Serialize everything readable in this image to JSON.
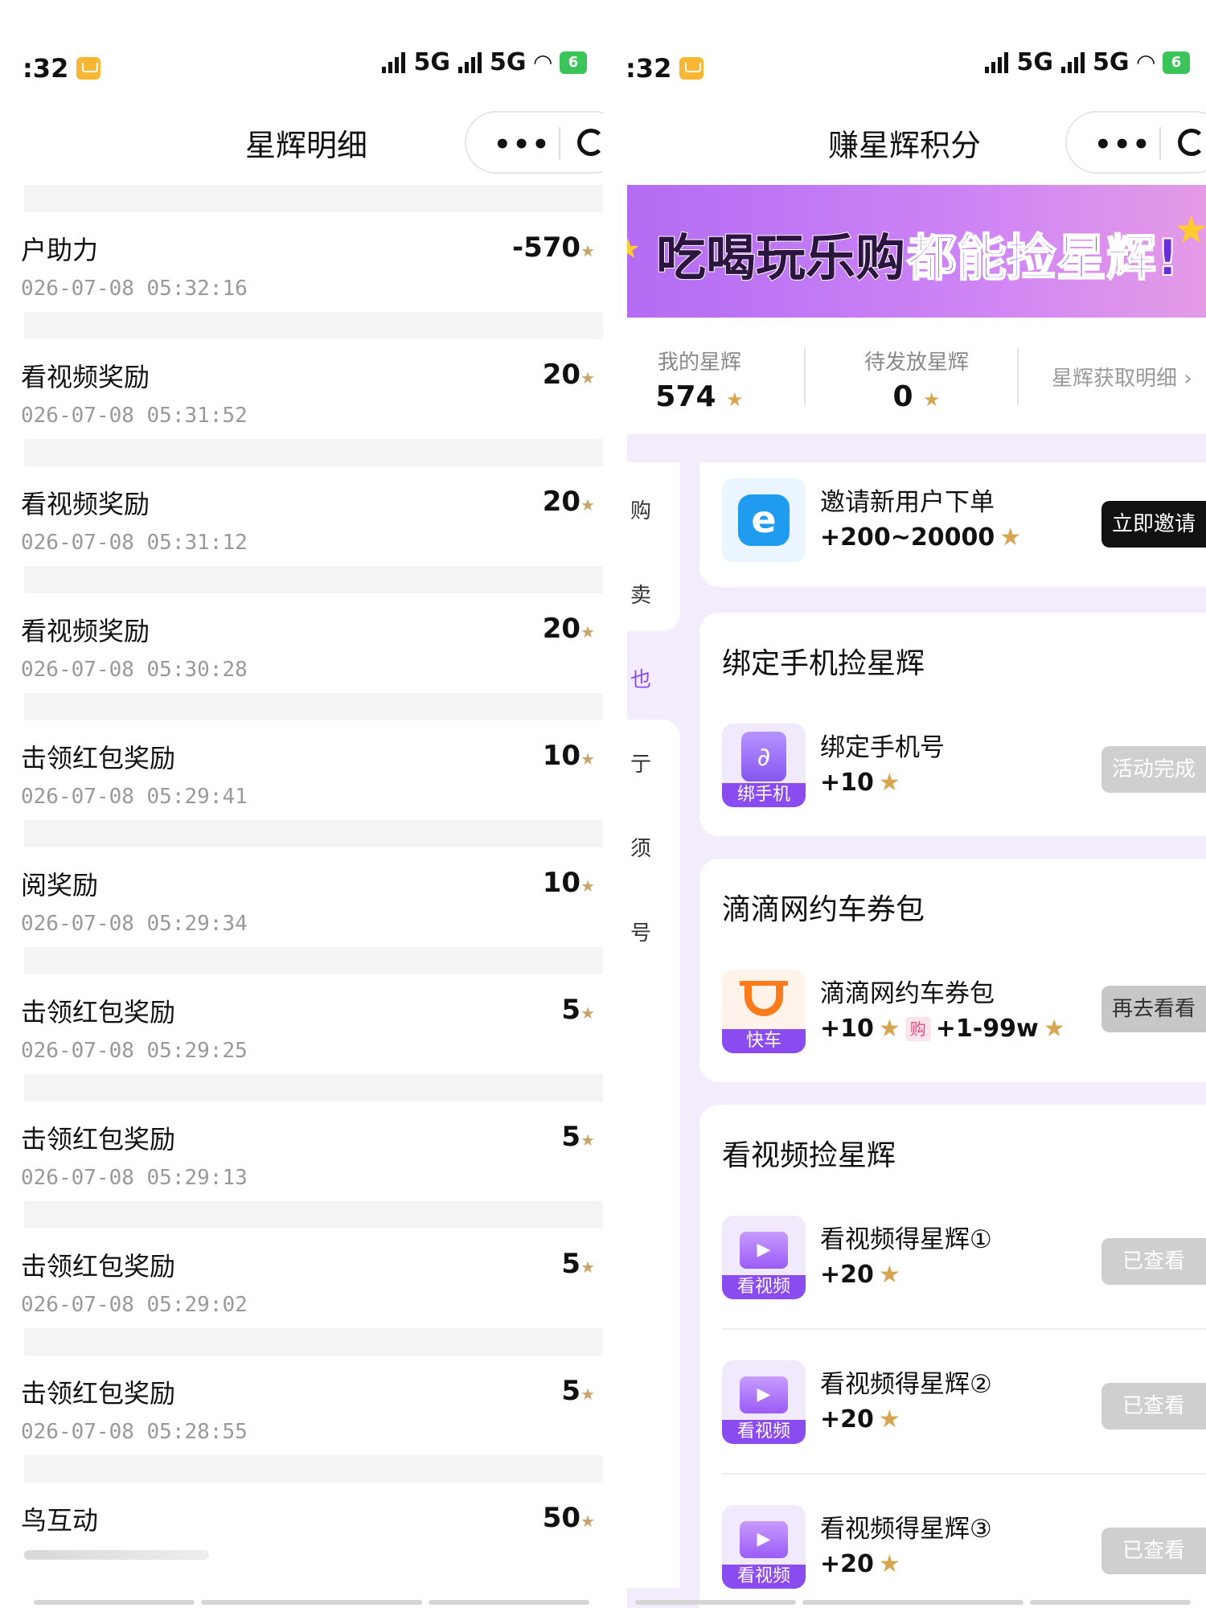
{
  "left": {
    "status": {
      "time": ":32",
      "network1": "5G",
      "network2": "5G",
      "battery": "6"
    },
    "title": "星辉明细",
    "capsule_dots": "•••",
    "records": [
      {
        "title": "户助力",
        "time": "026-07-08 05:32:16",
        "amount": "-570"
      },
      {
        "title": "看视频奖励",
        "time": "026-07-08 05:31:52",
        "amount": "20"
      },
      {
        "title": "看视频奖励",
        "time": "026-07-08 05:31:12",
        "amount": "20"
      },
      {
        "title": "看视频奖励",
        "time": "026-07-08 05:30:28",
        "amount": "20"
      },
      {
        "title": "击领红包奖励",
        "time": "026-07-08 05:29:41",
        "amount": "10"
      },
      {
        "title": "阅奖励",
        "time": "026-07-08 05:29:34",
        "amount": "10"
      },
      {
        "title": "击领红包奖励",
        "time": "026-07-08 05:29:25",
        "amount": "5"
      },
      {
        "title": "击领红包奖励",
        "time": "026-07-08 05:29:13",
        "amount": "5"
      },
      {
        "title": "击领红包奖励",
        "time": "026-07-08 05:29:02",
        "amount": "5"
      },
      {
        "title": "击领红包奖励",
        "time": "026-07-08 05:28:55",
        "amount": "5"
      },
      {
        "title": "鸟互动",
        "time": "",
        "amount": "50"
      }
    ]
  },
  "right": {
    "status": {
      "time": ":32",
      "network1": "5G",
      "network2": "5G",
      "battery": "6"
    },
    "title": "赚星辉积分",
    "capsule_dots": "•••",
    "banner": {
      "text1": "吃喝玩乐购",
      "text2": "都能捡星辉!"
    },
    "stats": {
      "my_label": "我的星辉",
      "my_value": "574",
      "pending_label": "待发放星辉",
      "pending_value": "0",
      "detail_link": "星辉获取明细 ›"
    },
    "sidenav": [
      "购",
      "卖",
      "也",
      "亍",
      "须",
      "号"
    ],
    "invite": {
      "name": "邀请新用户下单",
      "points": "+200~20000",
      "button": "立即邀请"
    },
    "bind_section": {
      "title": "绑定手机捡星辉",
      "item_name": "绑定手机号",
      "points": "+10",
      "thumb_label": "绑手机",
      "button": "活动完成"
    },
    "didi_section": {
      "title": "滴滴网约车券包",
      "item_name": "滴滴网约车券包",
      "points": "+10",
      "badge": "购",
      "points2": "+1-99w",
      "thumb_label": "快车",
      "button": "再去看看"
    },
    "video_section": {
      "title": "看视频捡星辉",
      "items": [
        {
          "name": "看视频得星辉①",
          "points": "+20",
          "thumb_label": "看视频",
          "button": "已查看"
        },
        {
          "name": "看视频得星辉②",
          "points": "+20",
          "thumb_label": "看视频",
          "button": "已查看"
        },
        {
          "name": "看视频得星辉③",
          "points": "+20",
          "thumb_label": "看视频",
          "button": "已查看"
        }
      ]
    },
    "colors": {
      "accent": "#8a4cf0",
      "star": "#d7a653",
      "banner_from": "#b36cf3",
      "lavender": "#f3ecfd"
    }
  }
}
